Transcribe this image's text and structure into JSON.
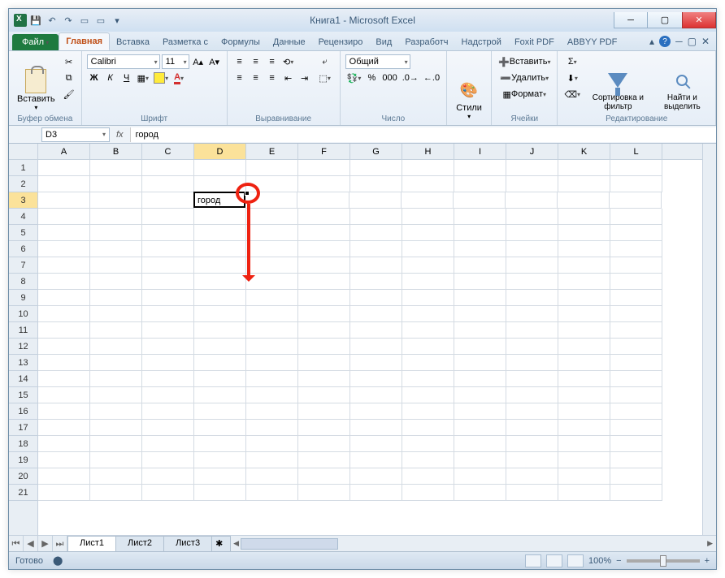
{
  "title": "Книга1  -  Microsoft Excel",
  "tabs": {
    "file": "Файл",
    "items": [
      "Главная",
      "Вставка",
      "Разметка с",
      "Формулы",
      "Данные",
      "Рецензиро",
      "Вид",
      "Разработч",
      "Надстрой",
      "Foxit PDF",
      "ABBYY PDF"
    ],
    "active": 0
  },
  "ribbon": {
    "clipboard": {
      "paste": "Вставить",
      "label": "Буфер обмена"
    },
    "font": {
      "name": "Calibri",
      "size": "11",
      "bold": "Ж",
      "italic": "К",
      "underline": "Ч",
      "label": "Шрифт"
    },
    "alignment": {
      "label": "Выравнивание"
    },
    "number": {
      "format": "Общий",
      "label": "Число",
      "pct": "%",
      "comma": "000"
    },
    "styles": {
      "btn": "Стили",
      "label": ""
    },
    "cells": {
      "insert": "Вставить",
      "delete": "Удалить",
      "format": "Формат",
      "label": "Ячейки"
    },
    "editing": {
      "sort": "Сортировка и фильтр",
      "find": "Найти и выделить",
      "label": "Редактирование"
    }
  },
  "namebox": "D3",
  "fx": "fx",
  "formula": "город",
  "columns": [
    "A",
    "B",
    "C",
    "D",
    "E",
    "F",
    "G",
    "H",
    "I",
    "J",
    "K",
    "L"
  ],
  "rows": [
    "1",
    "2",
    "3",
    "4",
    "5",
    "6",
    "7",
    "8",
    "9",
    "10",
    "11",
    "12",
    "13",
    "14",
    "15",
    "16",
    "17",
    "18",
    "19",
    "20",
    "21"
  ],
  "activeCol": 3,
  "activeRow": 2,
  "cellValue": "город",
  "sheets": [
    "Лист1",
    "Лист2",
    "Лист3"
  ],
  "activeSheet": 0,
  "status": "Готово",
  "zoom": "100%"
}
